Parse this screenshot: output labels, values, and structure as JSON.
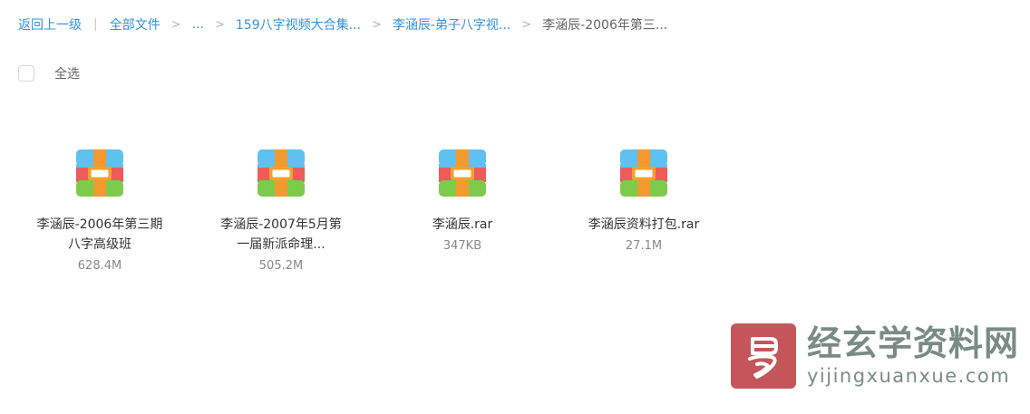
{
  "breadcrumb": {
    "back": "返回上一级",
    "separator": "|",
    "all_files": "全部文件",
    "ellipsis": "...",
    "arrow": ">",
    "level1": "159八字视频大合集...",
    "level2": "李涵辰-弟子八字视...",
    "current": "李涵辰-2006年第三..."
  },
  "selection": {
    "select_all_label": "全选",
    "checked": false
  },
  "files": [
    {
      "name": "李涵辰-2006年第三期八字高级班",
      "size": "628.4M",
      "icon": "archive-icon"
    },
    {
      "name": "李涵辰-2007年5月第一届新派命理...",
      "size": "505.2M",
      "icon": "archive-icon"
    },
    {
      "name": "李涵辰.rar",
      "size": "347KB",
      "icon": "archive-icon"
    },
    {
      "name": "李涵辰资料打包.rar",
      "size": "27.1M",
      "icon": "archive-icon"
    }
  ],
  "watermark": {
    "chinese": "经玄学资料网",
    "url": "yijingxuanxue.com",
    "seal_color": "#c4565b",
    "text_color": "#7a8b85"
  },
  "colors": {
    "link": "#3592d8",
    "archive_top": "#5ec1ef",
    "archive_middle": "#ee5b5b",
    "archive_bottom": "#7ccb4a",
    "archive_strap": "#f39a2e"
  }
}
